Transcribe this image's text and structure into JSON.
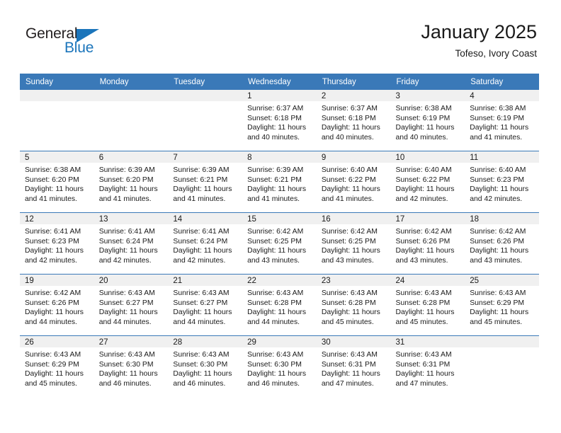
{
  "brand": {
    "name_top": "General",
    "name_bottom": "Blue",
    "color_dark": "#231f20",
    "color_blue": "#1b75bb"
  },
  "header": {
    "title": "January 2025",
    "subtitle": "Tofeso, Ivory Coast"
  },
  "theme": {
    "header_bar": "#3a79b8",
    "day_band": "#f0f0f0",
    "text": "#1a1a1a"
  },
  "weekday_headers": [
    "Sunday",
    "Monday",
    "Tuesday",
    "Wednesday",
    "Thursday",
    "Friday",
    "Saturday"
  ],
  "weeks": [
    [
      {
        "day": "",
        "sunrise": "",
        "sunset": "",
        "daylight_1": "",
        "daylight_2": "",
        "empty": true
      },
      {
        "day": "",
        "sunrise": "",
        "sunset": "",
        "daylight_1": "",
        "daylight_2": "",
        "empty": true
      },
      {
        "day": "",
        "sunrise": "",
        "sunset": "",
        "daylight_1": "",
        "daylight_2": "",
        "empty": true
      },
      {
        "day": "1",
        "sunrise": "Sunrise: 6:37 AM",
        "sunset": "Sunset: 6:18 PM",
        "daylight_1": "Daylight: 11 hours",
        "daylight_2": "and 40 minutes."
      },
      {
        "day": "2",
        "sunrise": "Sunrise: 6:37 AM",
        "sunset": "Sunset: 6:18 PM",
        "daylight_1": "Daylight: 11 hours",
        "daylight_2": "and 40 minutes."
      },
      {
        "day": "3",
        "sunrise": "Sunrise: 6:38 AM",
        "sunset": "Sunset: 6:19 PM",
        "daylight_1": "Daylight: 11 hours",
        "daylight_2": "and 40 minutes."
      },
      {
        "day": "4",
        "sunrise": "Sunrise: 6:38 AM",
        "sunset": "Sunset: 6:19 PM",
        "daylight_1": "Daylight: 11 hours",
        "daylight_2": "and 41 minutes."
      }
    ],
    [
      {
        "day": "5",
        "sunrise": "Sunrise: 6:38 AM",
        "sunset": "Sunset: 6:20 PM",
        "daylight_1": "Daylight: 11 hours",
        "daylight_2": "and 41 minutes."
      },
      {
        "day": "6",
        "sunrise": "Sunrise: 6:39 AM",
        "sunset": "Sunset: 6:20 PM",
        "daylight_1": "Daylight: 11 hours",
        "daylight_2": "and 41 minutes."
      },
      {
        "day": "7",
        "sunrise": "Sunrise: 6:39 AM",
        "sunset": "Sunset: 6:21 PM",
        "daylight_1": "Daylight: 11 hours",
        "daylight_2": "and 41 minutes."
      },
      {
        "day": "8",
        "sunrise": "Sunrise: 6:39 AM",
        "sunset": "Sunset: 6:21 PM",
        "daylight_1": "Daylight: 11 hours",
        "daylight_2": "and 41 minutes."
      },
      {
        "day": "9",
        "sunrise": "Sunrise: 6:40 AM",
        "sunset": "Sunset: 6:22 PM",
        "daylight_1": "Daylight: 11 hours",
        "daylight_2": "and 41 minutes."
      },
      {
        "day": "10",
        "sunrise": "Sunrise: 6:40 AM",
        "sunset": "Sunset: 6:22 PM",
        "daylight_1": "Daylight: 11 hours",
        "daylight_2": "and 42 minutes."
      },
      {
        "day": "11",
        "sunrise": "Sunrise: 6:40 AM",
        "sunset": "Sunset: 6:23 PM",
        "daylight_1": "Daylight: 11 hours",
        "daylight_2": "and 42 minutes."
      }
    ],
    [
      {
        "day": "12",
        "sunrise": "Sunrise: 6:41 AM",
        "sunset": "Sunset: 6:23 PM",
        "daylight_1": "Daylight: 11 hours",
        "daylight_2": "and 42 minutes."
      },
      {
        "day": "13",
        "sunrise": "Sunrise: 6:41 AM",
        "sunset": "Sunset: 6:24 PM",
        "daylight_1": "Daylight: 11 hours",
        "daylight_2": "and 42 minutes."
      },
      {
        "day": "14",
        "sunrise": "Sunrise: 6:41 AM",
        "sunset": "Sunset: 6:24 PM",
        "daylight_1": "Daylight: 11 hours",
        "daylight_2": "and 42 minutes."
      },
      {
        "day": "15",
        "sunrise": "Sunrise: 6:42 AM",
        "sunset": "Sunset: 6:25 PM",
        "daylight_1": "Daylight: 11 hours",
        "daylight_2": "and 43 minutes."
      },
      {
        "day": "16",
        "sunrise": "Sunrise: 6:42 AM",
        "sunset": "Sunset: 6:25 PM",
        "daylight_1": "Daylight: 11 hours",
        "daylight_2": "and 43 minutes."
      },
      {
        "day": "17",
        "sunrise": "Sunrise: 6:42 AM",
        "sunset": "Sunset: 6:26 PM",
        "daylight_1": "Daylight: 11 hours",
        "daylight_2": "and 43 minutes."
      },
      {
        "day": "18",
        "sunrise": "Sunrise: 6:42 AM",
        "sunset": "Sunset: 6:26 PM",
        "daylight_1": "Daylight: 11 hours",
        "daylight_2": "and 43 minutes."
      }
    ],
    [
      {
        "day": "19",
        "sunrise": "Sunrise: 6:42 AM",
        "sunset": "Sunset: 6:26 PM",
        "daylight_1": "Daylight: 11 hours",
        "daylight_2": "and 44 minutes."
      },
      {
        "day": "20",
        "sunrise": "Sunrise: 6:43 AM",
        "sunset": "Sunset: 6:27 PM",
        "daylight_1": "Daylight: 11 hours",
        "daylight_2": "and 44 minutes."
      },
      {
        "day": "21",
        "sunrise": "Sunrise: 6:43 AM",
        "sunset": "Sunset: 6:27 PM",
        "daylight_1": "Daylight: 11 hours",
        "daylight_2": "and 44 minutes."
      },
      {
        "day": "22",
        "sunrise": "Sunrise: 6:43 AM",
        "sunset": "Sunset: 6:28 PM",
        "daylight_1": "Daylight: 11 hours",
        "daylight_2": "and 44 minutes."
      },
      {
        "day": "23",
        "sunrise": "Sunrise: 6:43 AM",
        "sunset": "Sunset: 6:28 PM",
        "daylight_1": "Daylight: 11 hours",
        "daylight_2": "and 45 minutes."
      },
      {
        "day": "24",
        "sunrise": "Sunrise: 6:43 AM",
        "sunset": "Sunset: 6:28 PM",
        "daylight_1": "Daylight: 11 hours",
        "daylight_2": "and 45 minutes."
      },
      {
        "day": "25",
        "sunrise": "Sunrise: 6:43 AM",
        "sunset": "Sunset: 6:29 PM",
        "daylight_1": "Daylight: 11 hours",
        "daylight_2": "and 45 minutes."
      }
    ],
    [
      {
        "day": "26",
        "sunrise": "Sunrise: 6:43 AM",
        "sunset": "Sunset: 6:29 PM",
        "daylight_1": "Daylight: 11 hours",
        "daylight_2": "and 45 minutes."
      },
      {
        "day": "27",
        "sunrise": "Sunrise: 6:43 AM",
        "sunset": "Sunset: 6:30 PM",
        "daylight_1": "Daylight: 11 hours",
        "daylight_2": "and 46 minutes."
      },
      {
        "day": "28",
        "sunrise": "Sunrise: 6:43 AM",
        "sunset": "Sunset: 6:30 PM",
        "daylight_1": "Daylight: 11 hours",
        "daylight_2": "and 46 minutes."
      },
      {
        "day": "29",
        "sunrise": "Sunrise: 6:43 AM",
        "sunset": "Sunset: 6:30 PM",
        "daylight_1": "Daylight: 11 hours",
        "daylight_2": "and 46 minutes."
      },
      {
        "day": "30",
        "sunrise": "Sunrise: 6:43 AM",
        "sunset": "Sunset: 6:31 PM",
        "daylight_1": "Daylight: 11 hours",
        "daylight_2": "and 47 minutes."
      },
      {
        "day": "31",
        "sunrise": "Sunrise: 6:43 AM",
        "sunset": "Sunset: 6:31 PM",
        "daylight_1": "Daylight: 11 hours",
        "daylight_2": "and 47 minutes."
      },
      {
        "day": "",
        "sunrise": "",
        "sunset": "",
        "daylight_1": "",
        "daylight_2": "",
        "empty": true
      }
    ]
  ]
}
